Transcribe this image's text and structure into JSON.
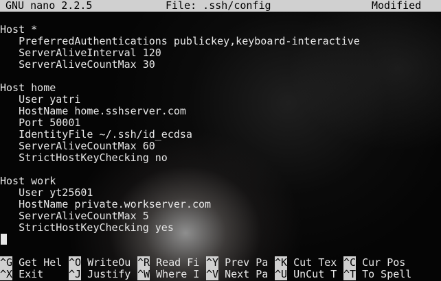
{
  "titlebar": {
    "app": "GNU nano 2.2.5",
    "file": "File: .ssh/config",
    "status": "Modified"
  },
  "editor": {
    "lines": [
      "Host *",
      "   PreferredAuthentications publickey,keyboard-interactive",
      "   ServerAliveInterval 120",
      "   ServerAliveCountMax 30",
      "",
      "Host home",
      "   User yatri",
      "   HostName home.sshserver.com",
      "   Port 50001",
      "   IdentityFile ~/.ssh/id_ecdsa",
      "   ServerAliveCountMax 60",
      "   StrictHostKeyChecking no",
      "",
      "Host work",
      "   User yt25601",
      "   HostName private.workserver.com",
      "   ServerAliveCountMax 5",
      "   StrictHostKeyChecking yes"
    ]
  },
  "shortcuts": {
    "row1": [
      {
        "key": "^G",
        "label": " Get Hel"
      },
      {
        "key": "^O",
        "label": " WriteOu"
      },
      {
        "key": "^R",
        "label": " Read Fi"
      },
      {
        "key": "^Y",
        "label": " Prev Pa"
      },
      {
        "key": "^K",
        "label": " Cut Tex"
      },
      {
        "key": "^C",
        "label": " Cur Pos"
      }
    ],
    "row2": [
      {
        "key": "^X",
        "label": " Exit"
      },
      {
        "key": "^J",
        "label": " Justify"
      },
      {
        "key": "^W",
        "label": " Where I"
      },
      {
        "key": "^V",
        "label": " Next Pa"
      },
      {
        "key": "^U",
        "label": " UnCut T"
      },
      {
        "key": "^T",
        "label": " To Spell"
      }
    ]
  },
  "colors": {
    "bar": "#d0d0d0",
    "text": "#e8e8e8",
    "background": "#050505"
  }
}
